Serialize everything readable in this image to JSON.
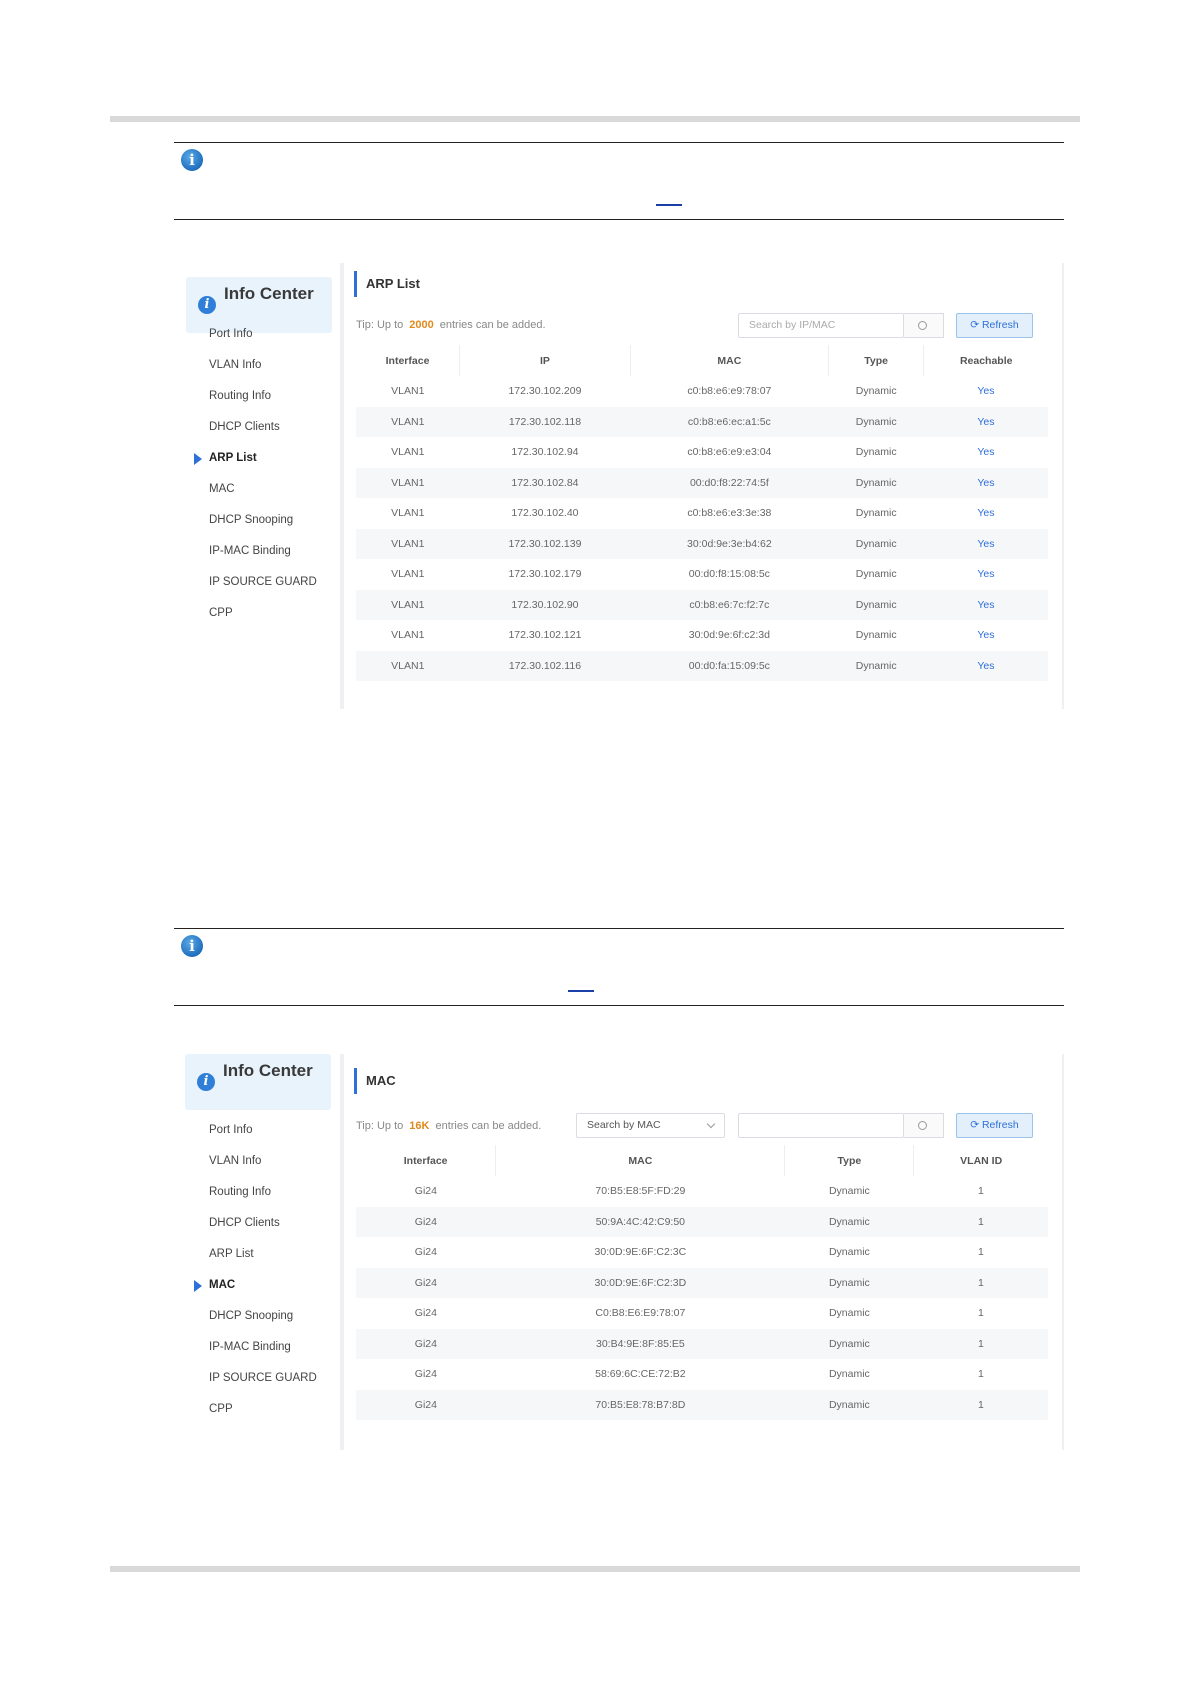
{
  "note1": {},
  "note2": {},
  "arp": {
    "sidebar_title": "Info Center",
    "sidebar_items": [
      "Port Info",
      "VLAN Info",
      "Routing Info",
      "DHCP Clients",
      "ARP List",
      "MAC",
      "DHCP Snooping",
      "IP-MAC Binding",
      "IP SOURCE GUARD",
      "CPP"
    ],
    "active_item": "ARP List",
    "title": "ARP List",
    "tip_prefix": "Tip: Up to",
    "tip_count": "2000",
    "tip_suffix": "entries can be added.",
    "search_placeholder": "Search by IP/MAC",
    "refresh_label": "Refresh",
    "columns": [
      "Interface",
      "IP",
      "MAC",
      "Type",
      "Reachable"
    ],
    "rows": [
      [
        "VLAN1",
        "172.30.102.209",
        "c0:b8:e6:e9:78:07",
        "Dynamic",
        "Yes"
      ],
      [
        "VLAN1",
        "172.30.102.118",
        "c0:b8:e6:ec:a1:5c",
        "Dynamic",
        "Yes"
      ],
      [
        "VLAN1",
        "172.30.102.94",
        "c0:b8:e6:e9:e3:04",
        "Dynamic",
        "Yes"
      ],
      [
        "VLAN1",
        "172.30.102.84",
        "00:d0:f8:22:74:5f",
        "Dynamic",
        "Yes"
      ],
      [
        "VLAN1",
        "172.30.102.40",
        "c0:b8:e6:e3:3e:38",
        "Dynamic",
        "Yes"
      ],
      [
        "VLAN1",
        "172.30.102.139",
        "30:0d:9e:3e:b4:62",
        "Dynamic",
        "Yes"
      ],
      [
        "VLAN1",
        "172.30.102.179",
        "00:d0:f8:15:08:5c",
        "Dynamic",
        "Yes"
      ],
      [
        "VLAN1",
        "172.30.102.90",
        "c0:b8:e6:7c:f2:7c",
        "Dynamic",
        "Yes"
      ],
      [
        "VLAN1",
        "172.30.102.121",
        "30:0d:9e:6f:c2:3d",
        "Dynamic",
        "Yes"
      ],
      [
        "VLAN1",
        "172.30.102.116",
        "00:d0:fa:15:09:5c",
        "Dynamic",
        "Yes"
      ]
    ]
  },
  "mac": {
    "sidebar_title": "Info Center",
    "sidebar_items": [
      "Port Info",
      "VLAN Info",
      "Routing Info",
      "DHCP Clients",
      "ARP List",
      "MAC",
      "DHCP Snooping",
      "IP-MAC Binding",
      "IP SOURCE GUARD",
      "CPP"
    ],
    "active_item": "MAC",
    "title": "MAC",
    "tip_prefix": "Tip: Up to",
    "tip_count": "16K",
    "tip_suffix": "entries can be added.",
    "search_mode": "Search by MAC",
    "refresh_label": "Refresh",
    "columns": [
      "Interface",
      "MAC",
      "Type",
      "VLAN ID"
    ],
    "rows": [
      [
        "Gi24",
        "70:B5:E8:5F:FD:29",
        "Dynamic",
        "1"
      ],
      [
        "Gi24",
        "50:9A:4C:42:C9:50",
        "Dynamic",
        "1"
      ],
      [
        "Gi24",
        "30:0D:9E:6F:C2:3C",
        "Dynamic",
        "1"
      ],
      [
        "Gi24",
        "30:0D:9E:6F:C2:3D",
        "Dynamic",
        "1"
      ],
      [
        "Gi24",
        "C0:B8:E6:E9:78:07",
        "Dynamic",
        "1"
      ],
      [
        "Gi24",
        "30:B4:9E:8F:85:E5",
        "Dynamic",
        "1"
      ],
      [
        "Gi24",
        "58:69:6C:CE:72:B2",
        "Dynamic",
        "1"
      ],
      [
        "Gi24",
        "70:B5:E8:78:B7:8D",
        "Dynamic",
        "1"
      ]
    ]
  }
}
